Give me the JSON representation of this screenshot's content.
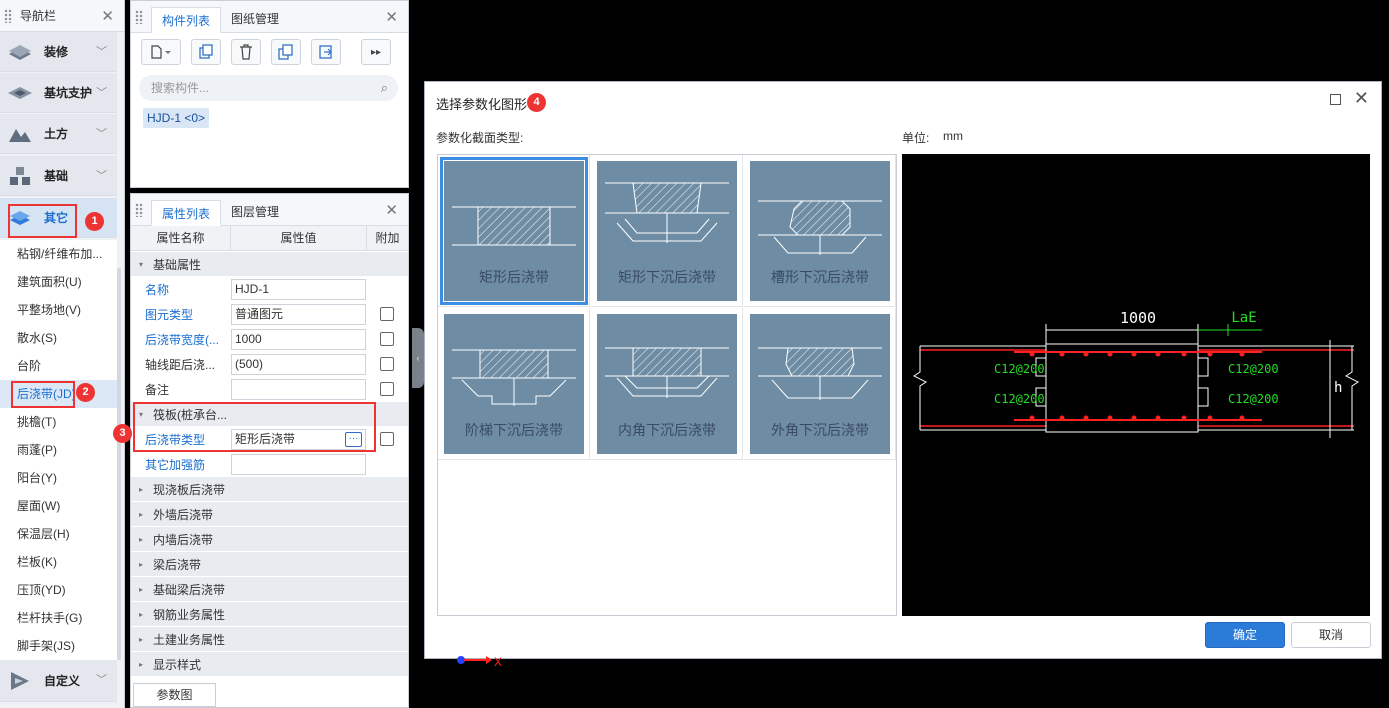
{
  "nav": {
    "title": "导航栏",
    "categories": [
      {
        "label": "装修",
        "icon": "decoration-icon"
      },
      {
        "label": "基坑支护",
        "icon": "pit-support-icon"
      },
      {
        "label": "土方",
        "icon": "earthwork-icon"
      },
      {
        "label": "基础",
        "icon": "foundation-icon"
      },
      {
        "label": "其它",
        "icon": "other-layers-icon"
      }
    ],
    "sub_items": [
      "粘钢/纤维布加...",
      "建筑面积(U)",
      "平整场地(V)",
      "散水(S)",
      "台阶",
      "后浇带(JD)",
      "挑檐(T)",
      "雨蓬(P)",
      "阳台(Y)",
      "屋面(W)",
      "保温层(H)",
      "栏板(K)",
      "压顶(YD)",
      "栏杆扶手(G)",
      "脚手架(JS)"
    ],
    "custom": {
      "label": "自定义",
      "icon": "custom-icon"
    }
  },
  "badges": [
    "1",
    "2",
    "3",
    "4"
  ],
  "component_panel": {
    "tabs": [
      "构件列表",
      "图纸管理"
    ],
    "search_placeholder": "搜索构件...",
    "items": [
      "HJD-1 <0>"
    ]
  },
  "props_panel": {
    "tabs": [
      "属性列表",
      "图层管理"
    ],
    "headers": [
      "属性名称",
      "属性值",
      "附加"
    ],
    "group_basic": "基础属性",
    "rows": [
      {
        "name": "名称",
        "value": "HJD-1",
        "blue": true,
        "check": false
      },
      {
        "name": "图元类型",
        "value": "普通图元",
        "blue": true,
        "check": true
      },
      {
        "name": "后浇带宽度(...",
        "value": "1000",
        "blue": true,
        "check": true
      },
      {
        "name": "轴线距后浇...",
        "value": "(500)",
        "blue": false,
        "check": true
      },
      {
        "name": "备注",
        "value": "",
        "blue": false,
        "check": true
      }
    ],
    "group_raft": "筏板(桩承台...",
    "raft_rows": [
      {
        "name": "后浇带类型",
        "value": "矩形后浇带",
        "blue": true,
        "check": true
      },
      {
        "name": "其它加强筋",
        "value": "",
        "blue": true,
        "check": false
      }
    ],
    "groups": [
      "现浇板后浇带",
      "外墙后浇带",
      "内墙后浇带",
      "梁后浇带",
      "基础梁后浇带",
      "钢筋业务属性",
      "土建业务属性",
      "显示样式"
    ],
    "param_button": "参数图"
  },
  "dialog": {
    "title": "选择参数化图形",
    "section_label": "参数化截面类型:",
    "unit_label": "单位:",
    "unit_value": "mm",
    "types": [
      "矩形后浇带",
      "矩形下沉后浇带",
      "槽形下沉后浇带",
      "阶梯下沉后浇带",
      "内角下沉后浇带",
      "外角下沉后浇带"
    ],
    "selected_index": 0,
    "preview": {
      "dim_width": "1000",
      "lae": "LaE",
      "rebar_left_top": "C12@200",
      "rebar_left_bottom": "C12@200",
      "rebar_right_top": "C12@200",
      "rebar_right_bottom": "C12@200",
      "height_label": "h"
    },
    "ok": "确定",
    "cancel": "取消"
  },
  "axis_label": "X",
  "colors": {
    "accent": "#1b6fd1",
    "highlight": "#e33",
    "thumb_bg": "#6e8da4",
    "rebar": "#ff2020",
    "dim_green": "#22dd22"
  }
}
